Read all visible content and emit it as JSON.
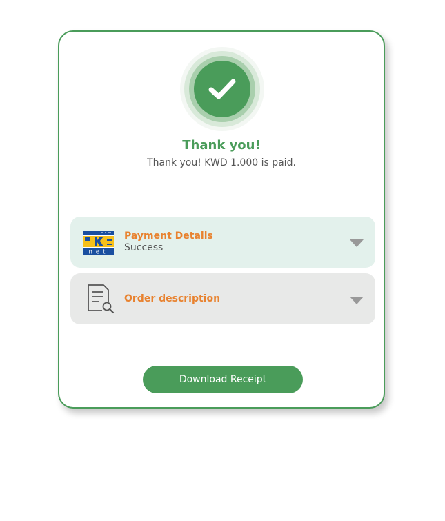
{
  "colors": {
    "brand_green": "#4a9c5a",
    "accent_orange": "#e8822f",
    "payment_bg": "#e3f1ec",
    "order_bg": "#e8e9e8"
  },
  "status": {
    "icon": "check-icon",
    "title": "Thank you!",
    "message": "Thank you! KWD 1.000 is paid."
  },
  "payment": {
    "logo": "knet-logo",
    "logo_text": "net",
    "label": "Payment Details",
    "status": "Success",
    "toggle_icon": "chevron-down-icon"
  },
  "order": {
    "icon": "document-search-icon",
    "label": "Order description",
    "toggle_icon": "chevron-down-icon"
  },
  "actions": {
    "download_label": "Download Receipt"
  }
}
